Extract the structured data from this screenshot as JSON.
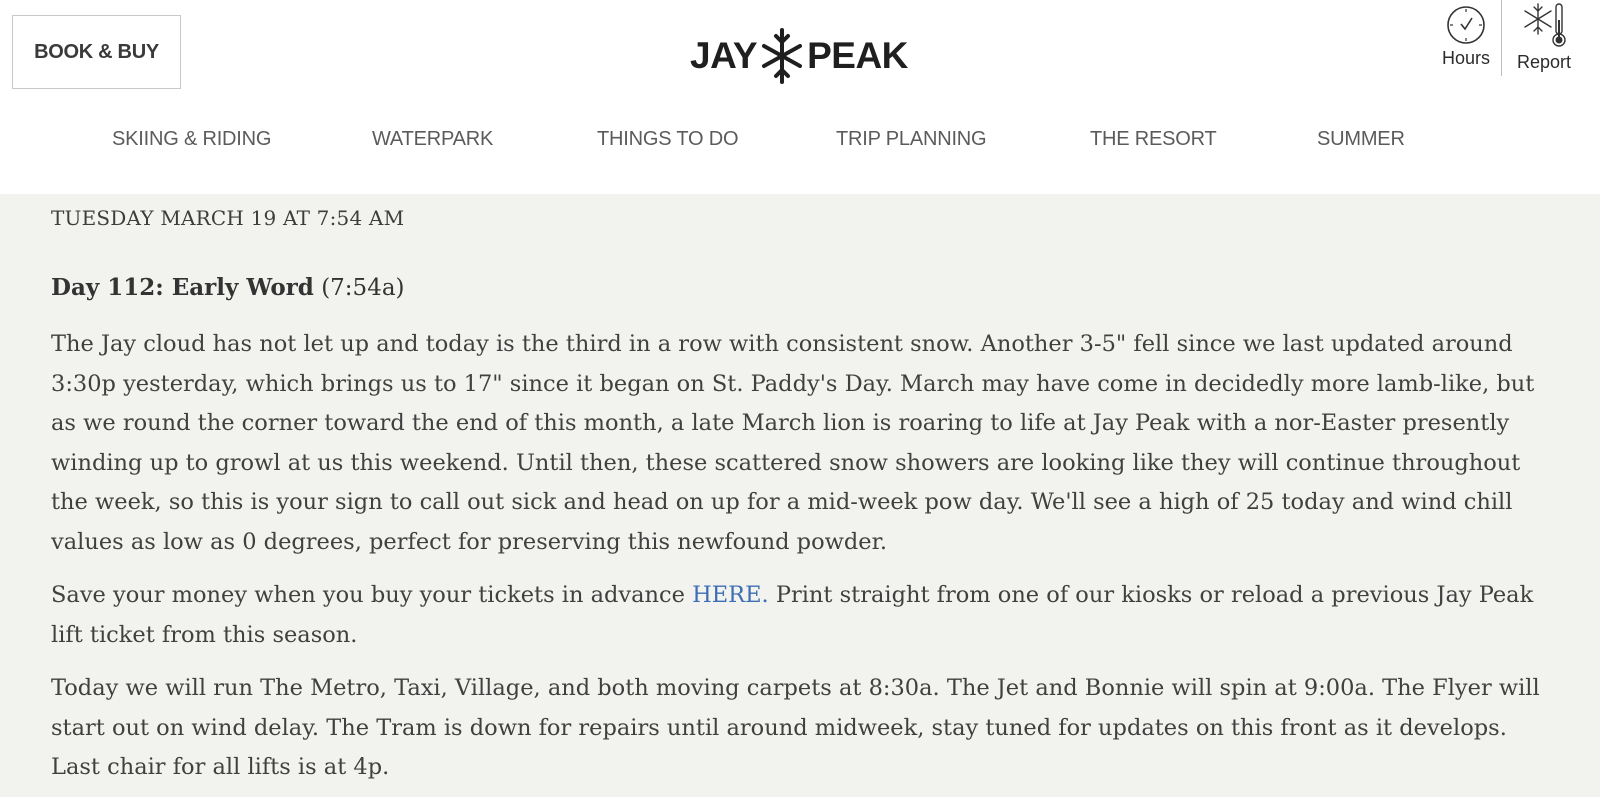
{
  "header": {
    "book_label": "BOOK & BUY",
    "logo_left": "JAY",
    "logo_right": "PEAK",
    "hours_label": "Hours",
    "report_label": "Report"
  },
  "nav": {
    "items": [
      {
        "label": "SKIING & RIDING"
      },
      {
        "label": "WATERPARK"
      },
      {
        "label": "THINGS TO DO"
      },
      {
        "label": "TRIP PLANNING"
      },
      {
        "label": "THE RESORT"
      },
      {
        "label": "SUMMER"
      }
    ]
  },
  "post": {
    "date": "TUESDAY MARCH 19 AT 7:54 AM",
    "title": "Day 112: Early Word",
    "title_time": "(7:54a)",
    "p1": "The Jay cloud has not let up and today is the third in a row with consistent snow. Another 3-5\" fell since we last updated around 3:30p yesterday, which brings us to 17\" since it began on St. Paddy's Day. March may have come in decidedly more lamb-like, but as we round the corner toward the end of this month, a late March lion is roaring to life at Jay Peak with a nor-Easter presently winding up to growl at us this weekend. Until then, these scattered snow showers are looking like they will continue throughout the week, so this is your sign to call out sick and head on up for a mid-week pow day. We'll see a high of 25 today and wind chill values as low as 0 degrees, perfect for preserving this newfound powder.",
    "p2_before": "Save your money when you buy your tickets in advance ",
    "p2_link": "HERE.",
    "p2_after": " Print straight from one of our kiosks or reload a previous Jay Peak lift ticket from this season.",
    "p3": "Today we will run The Metro, Taxi, Village, and both moving carpets at 8:30a. The Jet and Bonnie will spin at 9:00a. The Flyer will start out on wind delay. The Tram is down for repairs until around midweek, stay tuned for updates on this front as it develops. Last chair for all lifts is at 4p."
  },
  "colors": {
    "page_bg": "#f2f2ee",
    "header_bg": "#ffffff",
    "link": "#3d6eb5",
    "text": "#404040"
  }
}
